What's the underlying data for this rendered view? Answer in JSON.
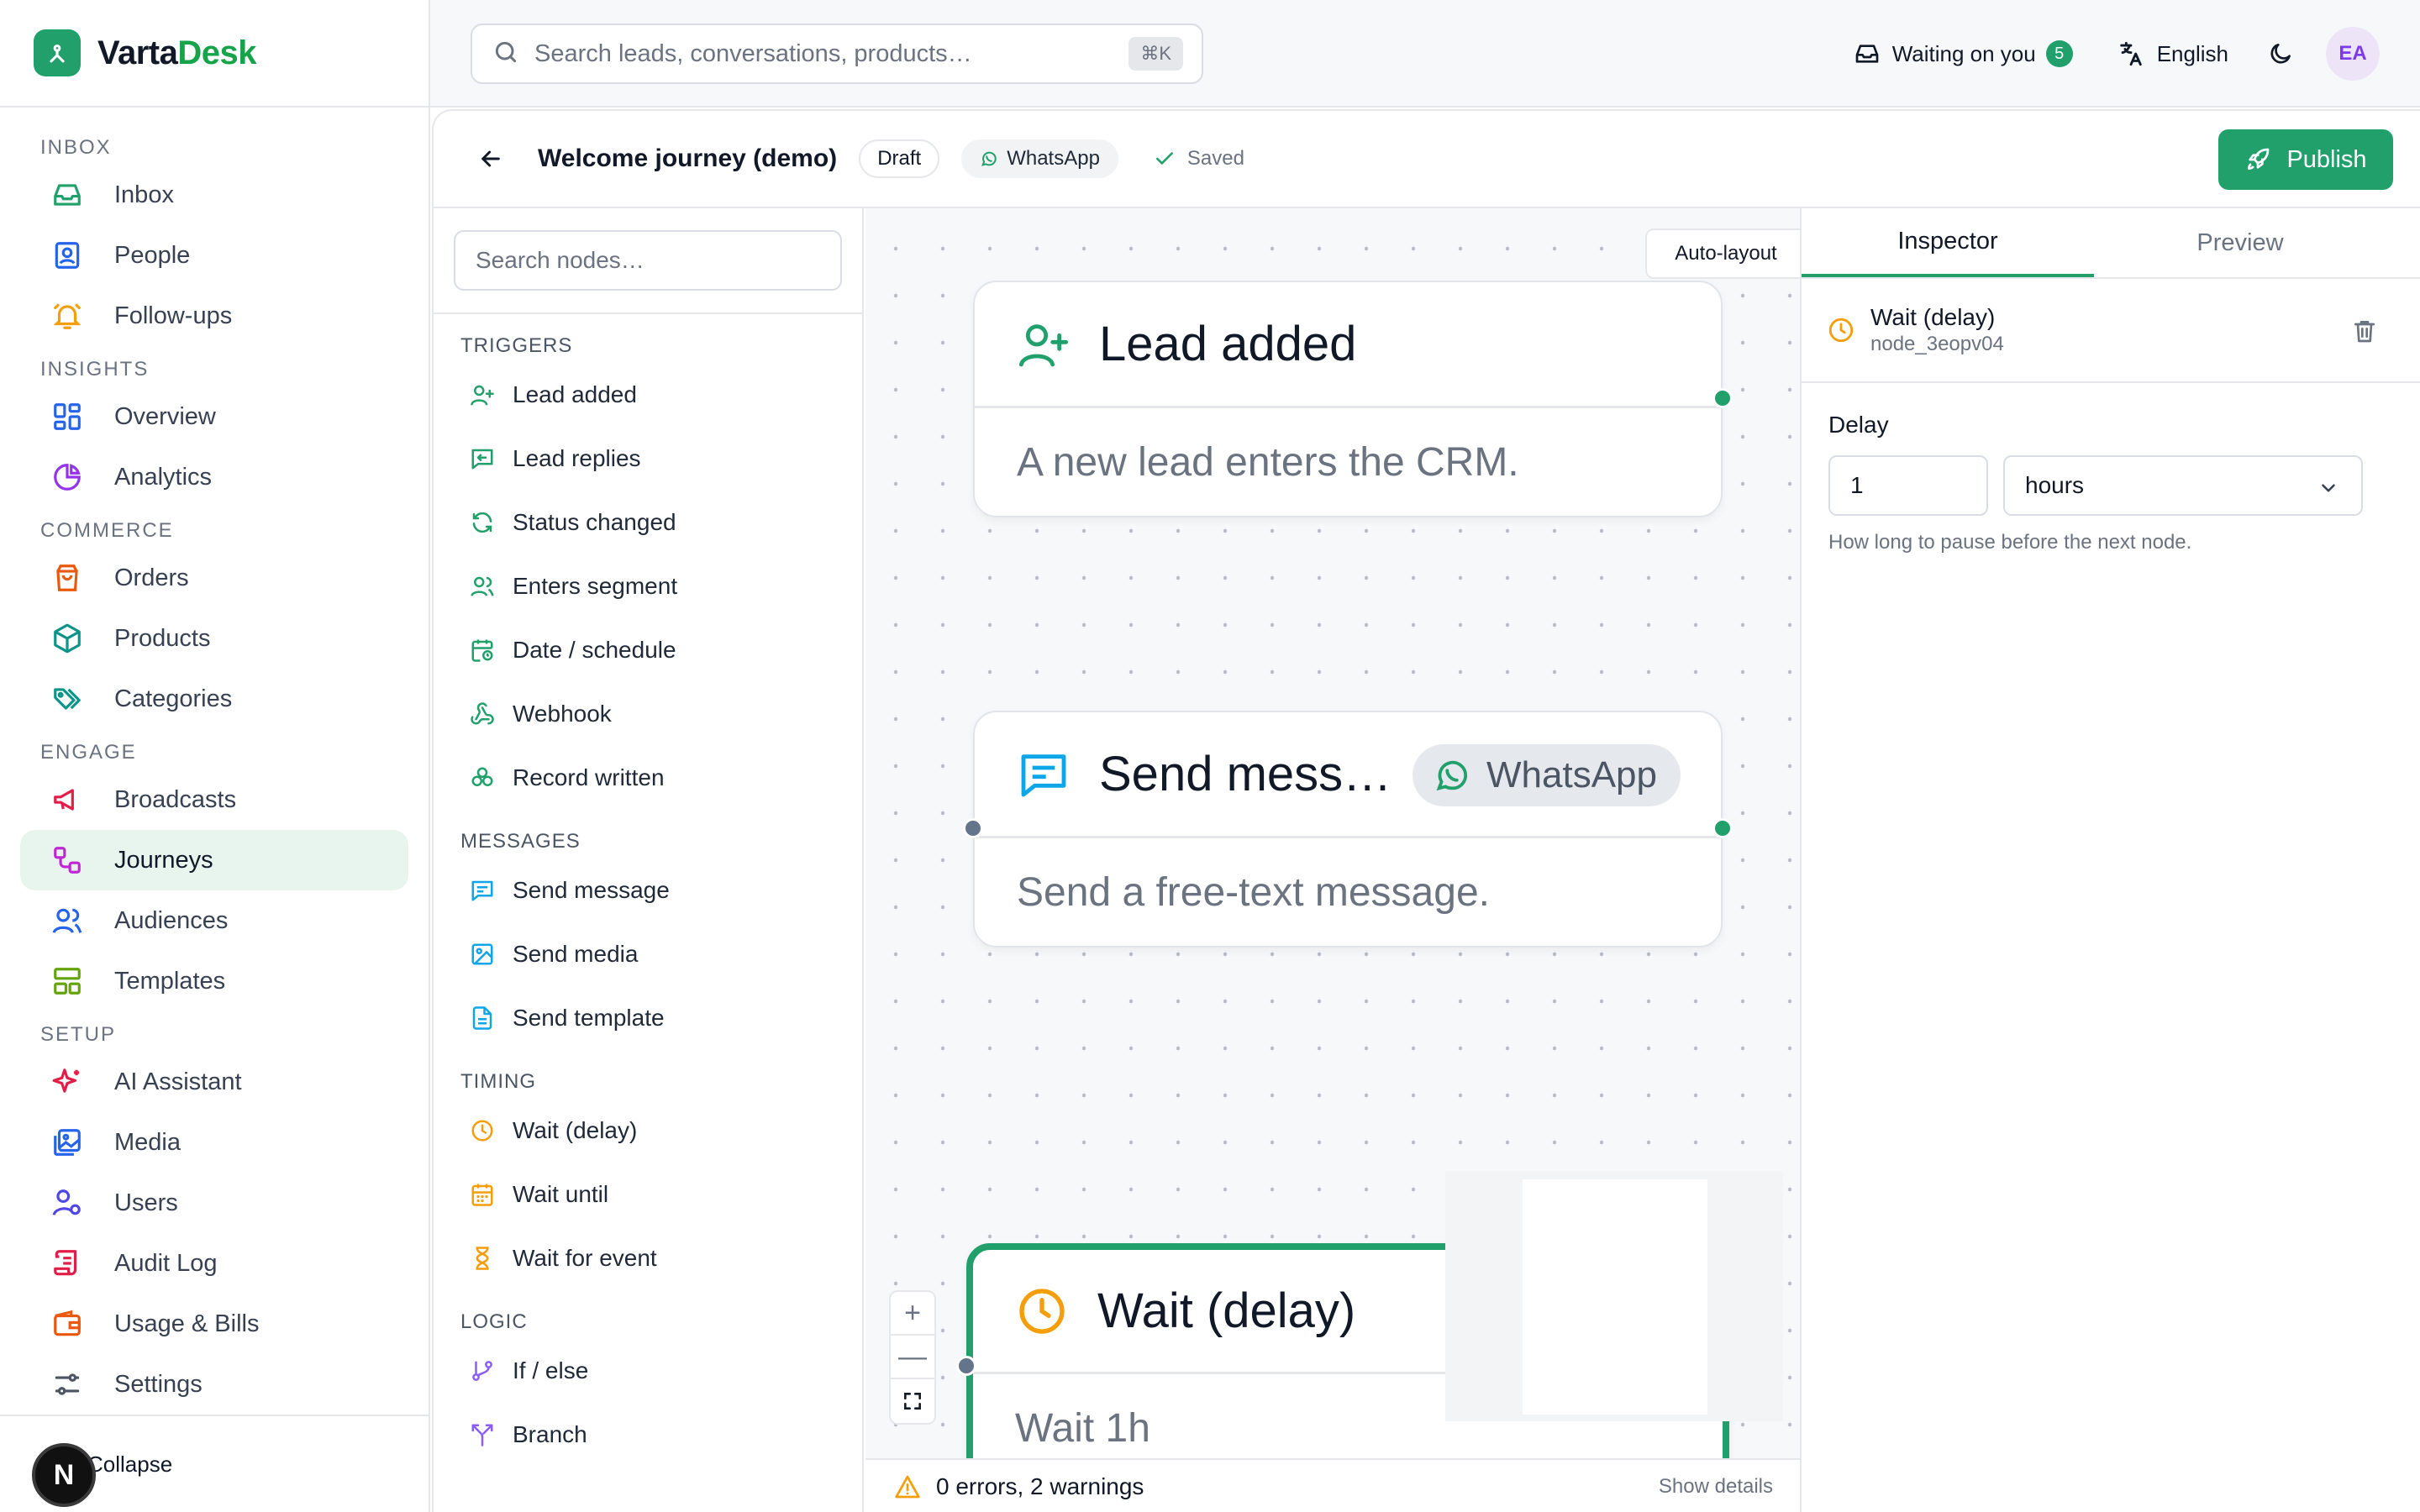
{
  "brand": {
    "name_prefix": "V",
    "name_mid": "arta",
    "name_suffix": "Desk"
  },
  "sidebar": {
    "sections": [
      {
        "title": "INBOX",
        "items": [
          {
            "label": "Inbox",
            "icon": "inbox-icon"
          },
          {
            "label": "People",
            "icon": "contact-icon"
          },
          {
            "label": "Follow-ups",
            "icon": "bell-icon"
          }
        ]
      },
      {
        "title": "INSIGHTS",
        "items": [
          {
            "label": "Overview",
            "icon": "dashboard-icon"
          },
          {
            "label": "Analytics",
            "icon": "pie-chart-icon"
          }
        ]
      },
      {
        "title": "COMMERCE",
        "items": [
          {
            "label": "Orders",
            "icon": "shopping-bag-icon"
          },
          {
            "label": "Products",
            "icon": "package-icon"
          },
          {
            "label": "Categories",
            "icon": "tags-icon"
          }
        ]
      },
      {
        "title": "ENGAGE",
        "items": [
          {
            "label": "Broadcasts",
            "icon": "megaphone-icon"
          },
          {
            "label": "Journeys",
            "icon": "workflow-icon",
            "active": true
          },
          {
            "label": "Audiences",
            "icon": "users-icon"
          },
          {
            "label": "Templates",
            "icon": "layout-icon"
          }
        ]
      },
      {
        "title": "SETUP",
        "items": [
          {
            "label": "AI Assistant",
            "icon": "sparkles-icon"
          },
          {
            "label": "Media",
            "icon": "image-icon"
          },
          {
            "label": "Users",
            "icon": "user-cog-icon"
          },
          {
            "label": "Audit Log",
            "icon": "scroll-icon"
          },
          {
            "label": "Usage & Bills",
            "icon": "wallet-icon"
          },
          {
            "label": "Settings",
            "icon": "sliders-icon"
          }
        ]
      }
    ],
    "collapse_label": "Collapse",
    "badge_letter": "N"
  },
  "topbar": {
    "search_placeholder": "Search leads, conversations, products…",
    "shortcut": "⌘K",
    "waiting_label": "Waiting on you",
    "waiting_count": "5",
    "language": "English",
    "avatar_initials": "EA"
  },
  "journey": {
    "title": "Welcome journey (demo)",
    "status": "Draft",
    "channel": "WhatsApp",
    "save_state": "Saved",
    "publish_label": "Publish"
  },
  "palette": {
    "search_placeholder": "Search nodes…",
    "sections": [
      {
        "title": "TRIGGERS",
        "items": [
          {
            "label": "Lead added",
            "icon": "user-plus-icon"
          },
          {
            "label": "Lead replies",
            "icon": "message-reply-icon"
          },
          {
            "label": "Status changed",
            "icon": "refresh-icon"
          },
          {
            "label": "Enters segment",
            "icon": "users-icon"
          },
          {
            "label": "Date / schedule",
            "icon": "calendar-clock-icon"
          },
          {
            "label": "Webhook",
            "icon": "webhook-icon"
          },
          {
            "label": "Record written",
            "icon": "database-icon"
          }
        ]
      },
      {
        "title": "MESSAGES",
        "items": [
          {
            "label": "Send message",
            "icon": "message-icon"
          },
          {
            "label": "Send media",
            "icon": "image-icon"
          },
          {
            "label": "Send template",
            "icon": "file-text-icon"
          }
        ]
      },
      {
        "title": "TIMING",
        "items": [
          {
            "label": "Wait (delay)",
            "icon": "clock-icon"
          },
          {
            "label": "Wait until",
            "icon": "calendar-icon"
          },
          {
            "label": "Wait for event",
            "icon": "hourglass-icon"
          }
        ]
      },
      {
        "title": "LOGIC",
        "items": [
          {
            "label": "If / else",
            "icon": "git-branch-icon"
          },
          {
            "label": "Branch",
            "icon": "split-icon"
          }
        ]
      }
    ]
  },
  "canvas": {
    "auto_layout_label": "Auto-layout",
    "nodes": [
      {
        "title": "Lead added",
        "description": "A new lead enters the CRM.",
        "icon": "user-plus-icon"
      },
      {
        "title": "Send mess…",
        "description": "Send a free-text message.",
        "icon": "message-icon",
        "channel": "WhatsApp"
      },
      {
        "title": "Wait (delay)",
        "description": "Wait 1h",
        "icon": "clock-icon",
        "selected": true
      }
    ],
    "zoom_in": "+",
    "zoom_out": "—",
    "status_text": "0 errors, 2 warnings",
    "show_details": "Show details"
  },
  "inspector": {
    "tabs": [
      "Inspector",
      "Preview"
    ],
    "active_tab": "Inspector",
    "node_name": "Wait (delay)",
    "node_id": "node_3eopv04",
    "delay_label": "Delay",
    "delay_value": "1",
    "delay_unit": "hours",
    "hint": "How long to pause before the next node."
  },
  "colors": {
    "accent": "#22a06b",
    "handle_in": "#64748b",
    "timing": "#f59e0b"
  }
}
